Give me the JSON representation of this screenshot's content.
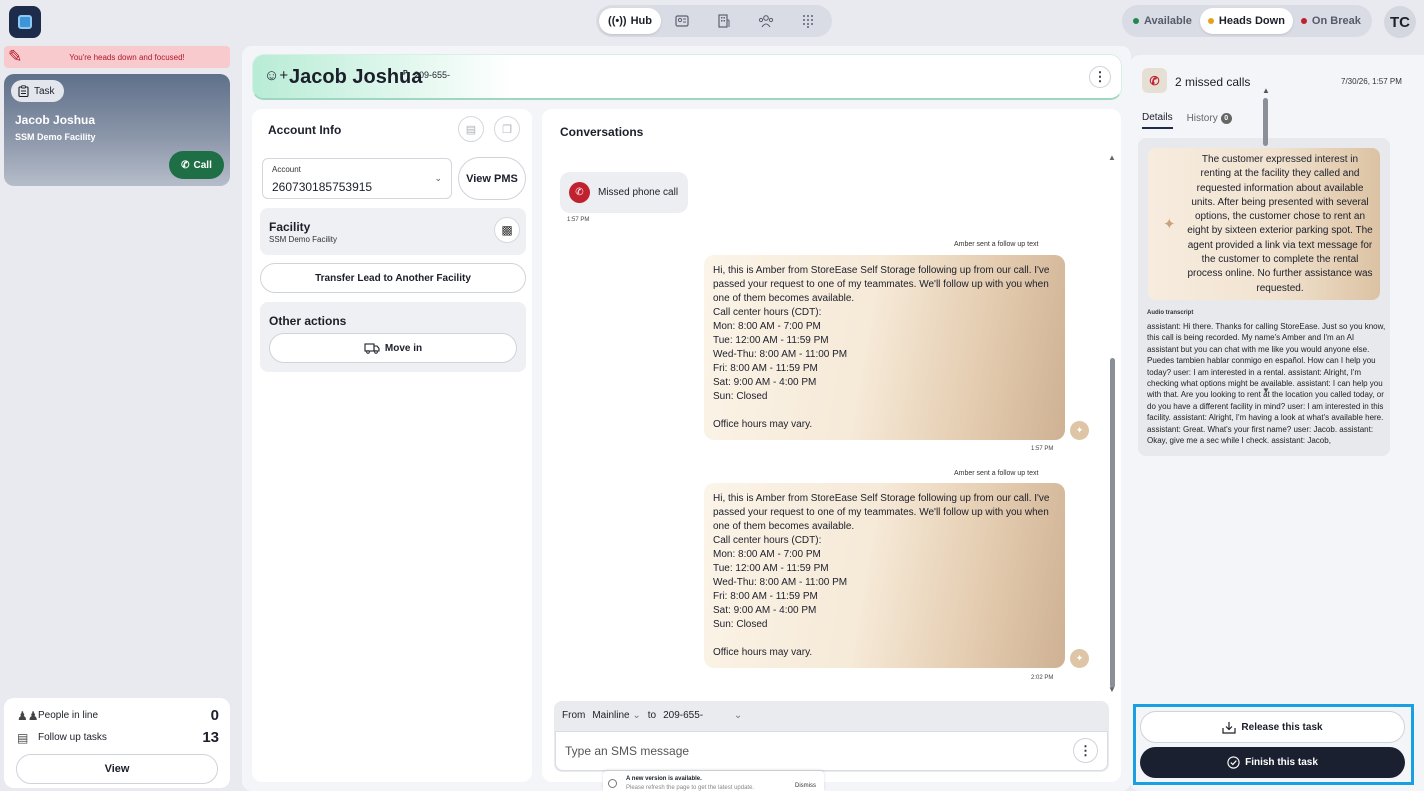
{
  "nav": {
    "hub_label": "Hub",
    "icons": [
      "contact-card-icon",
      "building-icon",
      "team-icon",
      "dialpad-icon"
    ]
  },
  "status": {
    "options": [
      {
        "label": "Available",
        "color": "#1f8a4c",
        "active": false
      },
      {
        "label": "Heads Down",
        "color": "#e8a21a",
        "active": true
      },
      {
        "label": "On Break",
        "color": "#c1202f",
        "active": false
      }
    ],
    "avatar_initials": "TC"
  },
  "focus_banner": "You're heads down and focused!",
  "task_card": {
    "chip_label": "Task",
    "name": "Jacob Joshua",
    "facility": "SSM Demo Facility",
    "call_label": "Call"
  },
  "queue": {
    "people_in_line_label": "People in line",
    "people_in_line_count": "0",
    "follow_up_label": "Follow up tasks",
    "follow_up_count": "13",
    "view_label": "View"
  },
  "contact": {
    "name": "Jacob Joshua",
    "phone_tag": "P",
    "phone": "209-655-"
  },
  "account_info": {
    "title": "Account Info",
    "account_label": "Account",
    "account_value": "260730185753915",
    "view_pms_label": "View PMS",
    "facility_title": "Facility",
    "facility_name": "SSM Demo Facility",
    "transfer_label": "Transfer Lead to Another Facility",
    "other_actions_title": "Other actions",
    "move_in_label": "Move in"
  },
  "conversations": {
    "title": "Conversations",
    "missed_call_label": "Missed phone call",
    "missed_call_time": "1:57 PM",
    "messages": [
      {
        "sender_label": "Amber sent a follow up text",
        "text": "Hi, this is Amber from StoreEase Self Storage following up from our call. I've passed your request to one of my teammates. We'll follow up with you when one of them becomes available.\nCall center hours (CDT):\nMon: 8:00 AM - 7:00 PM\nTue: 12:00 AM - 11:59 PM\nWed-Thu: 8:00 AM - 11:00 PM\nFri: 8:00 AM - 11:59 PM\nSat: 9:00 AM - 4:00 PM\nSun: Closed\n\nOffice hours may vary.",
        "time": "1:57 PM"
      },
      {
        "sender_label": "Amber sent a follow up text",
        "text": "Hi, this is Amber from StoreEase Self Storage following up from our call. I've passed your request to one of my teammates. We'll follow up with you when one of them becomes available.\nCall center hours (CDT):\nMon: 8:00 AM - 7:00 PM\nTue: 12:00 AM - 11:59 PM\nWed-Thu: 8:00 AM - 11:00 PM\nFri: 8:00 AM - 11:59 PM\nSat: 9:00 AM - 4:00 PM\nSun: Closed\n\nOffice hours may vary.",
        "time": "2:02 PM"
      }
    ],
    "composer": {
      "from_label": "From",
      "from_value": "Mainline",
      "to_label": "to",
      "to_value": "209-655-",
      "placeholder": "Type an SMS message"
    }
  },
  "toast": {
    "title": "A new version is available.",
    "subtitle": "Please refresh the page to get the latest update.",
    "dismiss_label": "Dismiss"
  },
  "right_panel": {
    "title": "2 missed calls",
    "timestamp": "7/30/26, 1:57 PM",
    "tabs": [
      {
        "label": "Details",
        "active": true
      },
      {
        "label": "History",
        "badge": "0",
        "active": false
      }
    ],
    "summary": "The customer expressed interest in renting at the facility they called and requested information about available units. After being presented with several options, the customer chose to rent an eight by sixteen exterior parking spot. The agent provided a link via text message for the customer to complete the rental process online. No further assistance was requested.",
    "transcript_label": "Audio transcript",
    "transcript": "assistant: Hi there. Thanks for calling StoreEase. Just so you know, this call is being recorded. My name's Amber and I'm an AI assistant but you can chat with me like you would anyone else. Puedes tambien hablar conmigo en español. How can I help you today? user: I am interested in a rental. assistant: Alright, I'm checking what options might be available. assistant: I can help you with that. Are you looking to rent at the location you called today, or do you have a different facility in mind? user: I am interested in this facility. assistant: Alright, I'm having a look at what's available here. assistant: Great. What's your first name? user: Jacob. assistant: Okay, give me a sec while I check. assistant: Jacob,",
    "release_label": "Release this task",
    "finish_label": "Finish this task"
  }
}
